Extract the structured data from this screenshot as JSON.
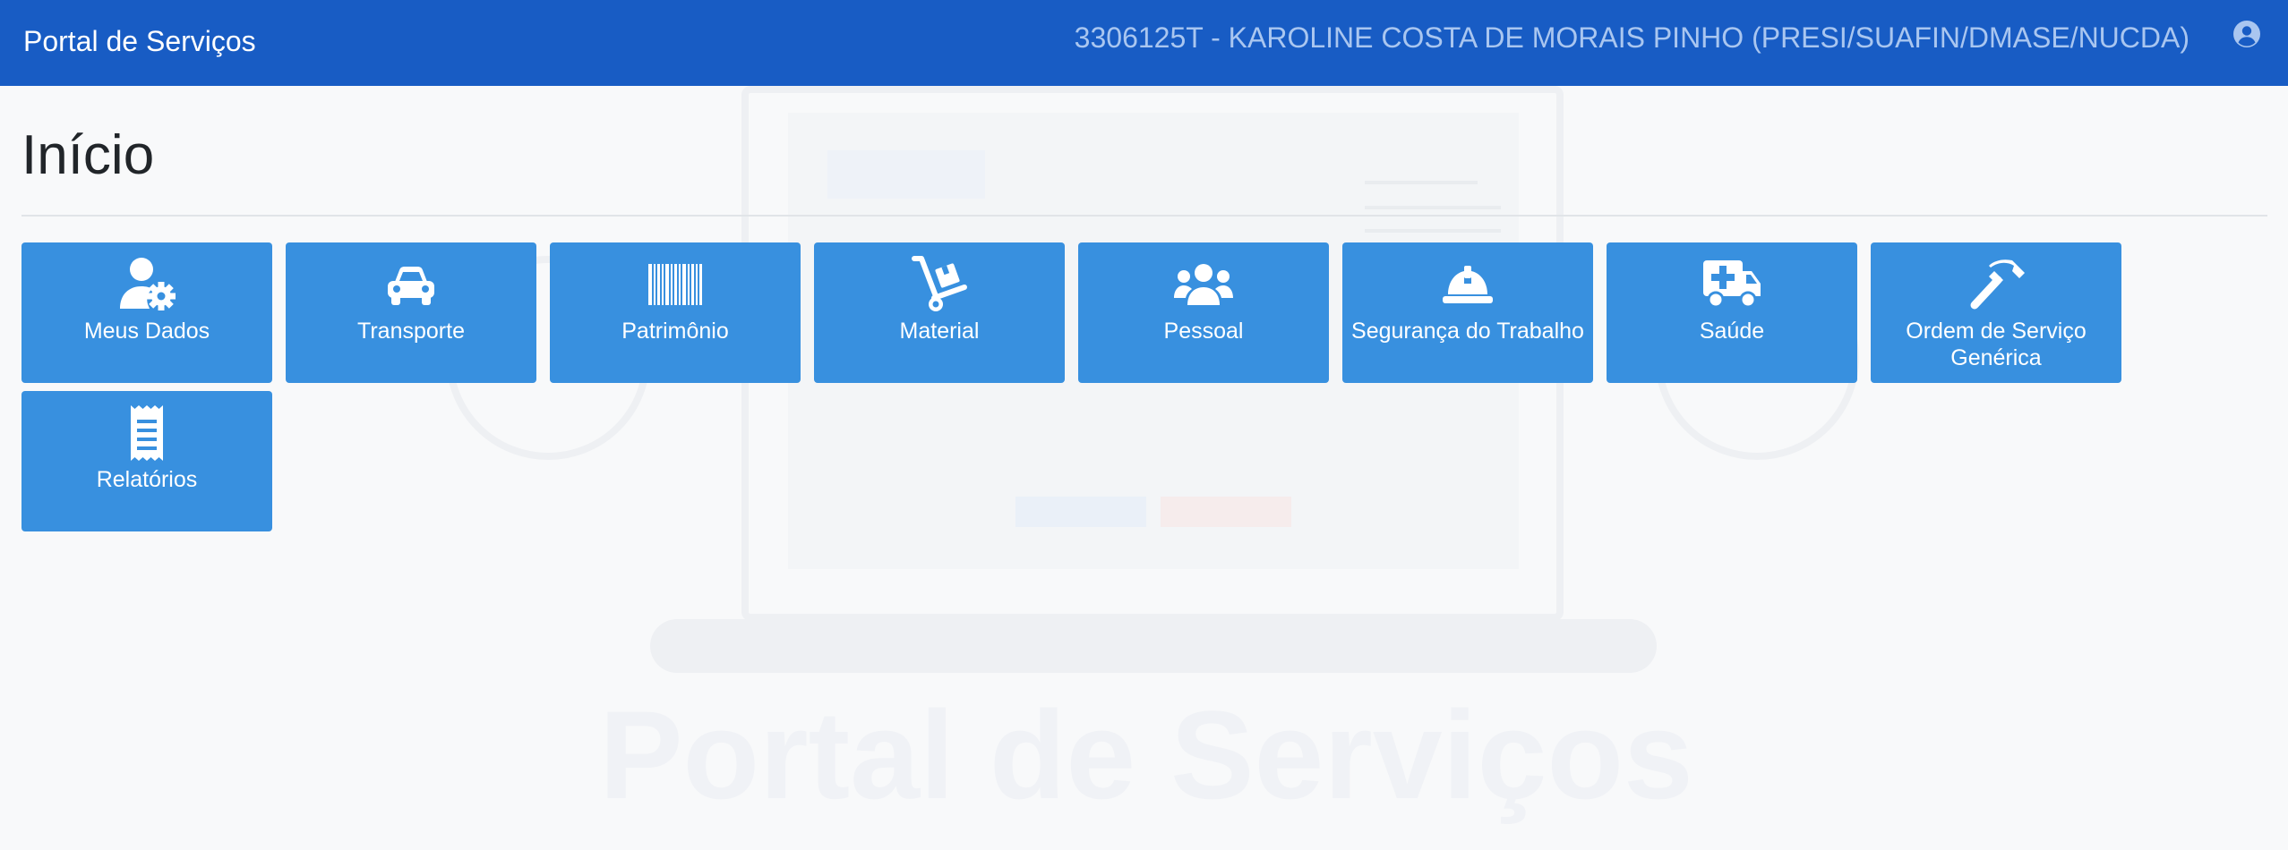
{
  "navbar": {
    "brand": "Portal de Serviços",
    "user": "3306125T - KAROLINE COSTA DE MORAIS PINHO (PRESI/SUAFIN/DMASE/NUCDA)",
    "user_icon": "user-circle-icon"
  },
  "page": {
    "title": "Início"
  },
  "tiles": [
    {
      "label": "Meus Dados",
      "icon": "user-gear-icon"
    },
    {
      "label": "Transporte",
      "icon": "car-icon"
    },
    {
      "label": "Patrimônio",
      "icon": "barcode-icon"
    },
    {
      "label": "Material",
      "icon": "hand-truck-icon"
    },
    {
      "label": "Pessoal",
      "icon": "users-icon"
    },
    {
      "label": "Segurança do Trabalho",
      "icon": "hard-hat-icon"
    },
    {
      "label": "Saúde",
      "icon": "ambulance-icon"
    },
    {
      "label": "Ordem de Serviço Genérica",
      "icon": "hammer-icon"
    },
    {
      "label": "Relatórios",
      "icon": "receipt-icon"
    }
  ],
  "background": {
    "watermark": "Portal de Serviços"
  },
  "colors": {
    "navbar": "#185cc4",
    "tile": "#3890df",
    "background": "#f8f9fa"
  }
}
